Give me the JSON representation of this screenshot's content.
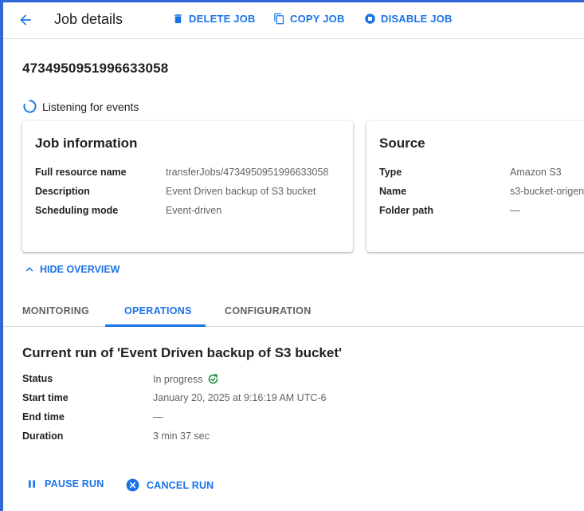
{
  "header": {
    "title": "Job details",
    "actions": {
      "delete": "DELETE JOB",
      "copy": "COPY JOB",
      "disable": "DISABLE JOB"
    }
  },
  "job": {
    "id": "4734950951996633058",
    "status_text": "Listening for events"
  },
  "job_info": {
    "title": "Job information",
    "rows": [
      {
        "label": "Full resource name",
        "value": "transferJobs/4734950951996633058"
      },
      {
        "label": "Description",
        "value": "Event Driven backup of S3 bucket"
      },
      {
        "label": "Scheduling mode",
        "value": "Event-driven"
      }
    ]
  },
  "source": {
    "title": "Source",
    "rows": [
      {
        "label": "Type",
        "value": "Amazon S3"
      },
      {
        "label": "Name",
        "value": "s3-bucket-origen"
      },
      {
        "label": "Folder path",
        "value": "—"
      }
    ]
  },
  "overview_toggle": "HIDE OVERVIEW",
  "tabs": [
    {
      "label": "MONITORING",
      "active": false
    },
    {
      "label": "OPERATIONS",
      "active": true
    },
    {
      "label": "CONFIGURATION",
      "active": false
    }
  ],
  "current_run": {
    "title": "Current run of 'Event Driven backup of S3 bucket'",
    "rows": [
      {
        "label": "Status",
        "value": "In progress"
      },
      {
        "label": "Start time",
        "value": "January 20, 2025 at 9:16:19 AM UTC-6"
      },
      {
        "label": "End time",
        "value": "—"
      },
      {
        "label": "Duration",
        "value": "3 min 37 sec"
      }
    ]
  },
  "run_actions": {
    "pause": "PAUSE RUN",
    "cancel": "CANCEL RUN"
  },
  "colors": {
    "accent": "#1a73e8",
    "frame": "#3367d6",
    "success": "#1e8e3e"
  }
}
